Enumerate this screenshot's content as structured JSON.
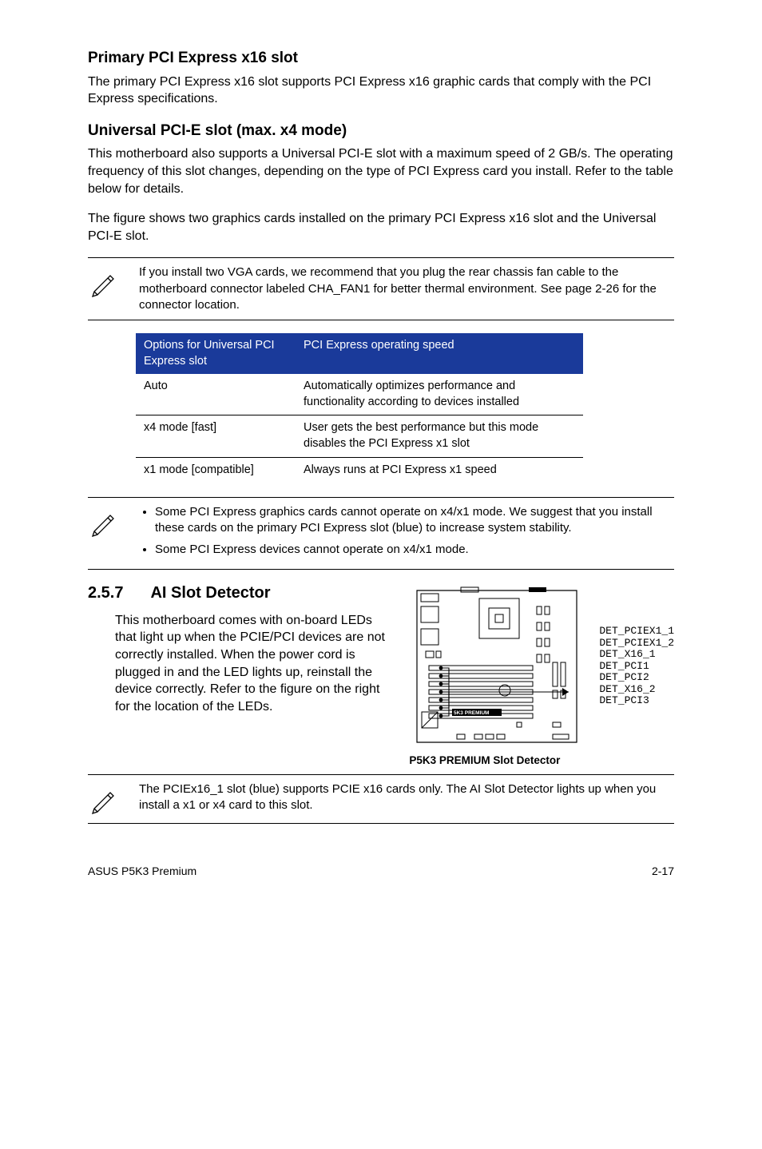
{
  "s1": {
    "title": "Primary PCI Express x16 slot",
    "para": "The primary PCI Express x16 slot supports PCI Express x16 graphic cards that comply with the PCI Express specifications."
  },
  "s2": {
    "title": "Universal PCI-E slot (max. x4 mode)",
    "p1": "This motherboard also supports a Universal PCI-E slot with a maximum speed of 2 GB/s. The operating frequency of this slot changes, depending on the type of PCI Express card you install. Refer to the table below for details.",
    "p2": "The figure shows two graphics cards installed on the primary PCI Express x16 slot and the Universal PCI-E slot."
  },
  "note1": "If you install two VGA cards, we recommend that you plug the rear chassis fan cable to the motherboard connector labeled CHA_FAN1 for better thermal environment. See page 2-26 for the connector location.",
  "table": {
    "h1": "Options for Universal PCI Express slot",
    "h2": "PCI Express operating speed",
    "rows": [
      {
        "c1": "Auto",
        "c2": "Automatically optimizes performance and functionality according to devices installed"
      },
      {
        "c1": "x4 mode [fast]",
        "c2": "User gets the best performance but this mode disables the PCI Express x1 slot"
      },
      {
        "c1": "x1 mode [compatible]",
        "c2": "Always runs at PCI Express x1 speed"
      }
    ]
  },
  "note2": {
    "b1": "Some PCI Express graphics cards cannot operate on x4/x1 mode. We suggest that you install these cards on the primary PCI Express slot (blue) to increase system stability.",
    "b2": "Some PCI Express devices cannot operate on x4/x1  mode."
  },
  "ai": {
    "num": "2.5.7",
    "title": "AI Slot Detector",
    "body": "This motherboard comes with on-board LEDs that light up when the PCIE/PCI devices are not correctly installed. When the power cord is plugged in and the LED lights up, reinstall the device correctly. Refer to the figure on the right for the location of the LEDs.",
    "caption": "P5K3 PREMIUM Slot Detector",
    "labels": "DET_PCIEX1_1\nDET_PCIEX1_2\nDET_X16_1\nDET_PCI1\nDET_PCI2\nDET_X16_2\nDET_PCI3",
    "boardlabel": "5K3 PREMIUM"
  },
  "note3": "The PCIEx16_1 slot (blue) supports PCIE x16 cards only. The AI Slot Detector lights up when you install a x1 or x4 card to this slot.",
  "footer": {
    "left": "ASUS P5K3 Premium",
    "right": "2-17"
  }
}
